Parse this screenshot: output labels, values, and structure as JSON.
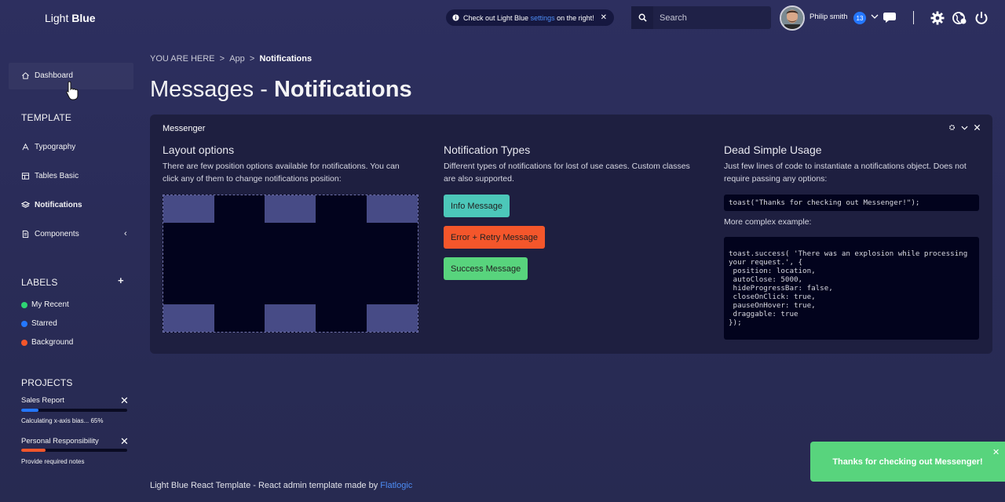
{
  "brand": {
    "light": "Light",
    "bold": "Blue"
  },
  "sidebar": {
    "items": [
      {
        "label": "Dashboard"
      },
      {
        "label": "Typography"
      },
      {
        "label": "Tables Basic"
      },
      {
        "label": "Notifications"
      },
      {
        "label": "Components"
      }
    ],
    "template_title": "TEMPLATE",
    "labels_title": "LABELS",
    "labels": [
      {
        "label": "My Recent",
        "color": "#2ed573"
      },
      {
        "label": "Starred",
        "color": "#2477ff"
      },
      {
        "label": "Background",
        "color": "#f4562b"
      }
    ],
    "projects_title": "PROJECTS",
    "projects": [
      {
        "title": "Sales Report",
        "note": "Calculating x-axis bias... 65%",
        "progress": 0.16,
        "color": "#2477ff"
      },
      {
        "title": "Personal Responsibility",
        "note": "Provide required notes",
        "progress": 0.23,
        "color": "#f4562b"
      }
    ]
  },
  "header": {
    "alert_prefix": "Check out Light Blue ",
    "alert_link": "settings",
    "alert_suffix": " on the right!",
    "search_placeholder": "Search",
    "username": "Philip smith",
    "badge_count": "13"
  },
  "breadcrumb": {
    "prefix": "YOU ARE HERE",
    "sep": ">",
    "app": "App",
    "current": "Notifications"
  },
  "page_title": {
    "light": "Messages - ",
    "bold": "Notifications"
  },
  "panel": {
    "title": "Messenger",
    "layout": {
      "title": "Layout options",
      "text": "There are few position options available for notifications. You can click any of them to change notifications position:"
    },
    "types": {
      "title": "Notification Types",
      "text": "Different types of notifications for lost of use cases. Custom classes are also supported.",
      "buttons": [
        {
          "label": "Info Message",
          "color": "#4cc7b9"
        },
        {
          "label": "Error + Retry Message",
          "color": "#f4562b"
        },
        {
          "label": "Success Message",
          "color": "#58d47d"
        }
      ]
    },
    "usage": {
      "title": "Dead Simple Usage",
      "text": "Just few lines of code to instantiate a notifications object. Does not require passing any options:",
      "code_simple": "toast(\"Thanks for checking out Messenger!\");",
      "complex_label": "More complex example:",
      "code_complex": "toast.success( 'There was an explosion while processing\nyour request.', {\n position: location,\n autoClose: 5000,\n hideProgressBar: false,\n closeOnClick: true,\n pauseOnHover: true,\n draggable: true\n});"
    }
  },
  "footer": {
    "text": "Light Blue React Template - React admin template made by ",
    "link": "Flatlogic"
  },
  "toast": {
    "text": "Thanks for checking out Messenger!"
  }
}
